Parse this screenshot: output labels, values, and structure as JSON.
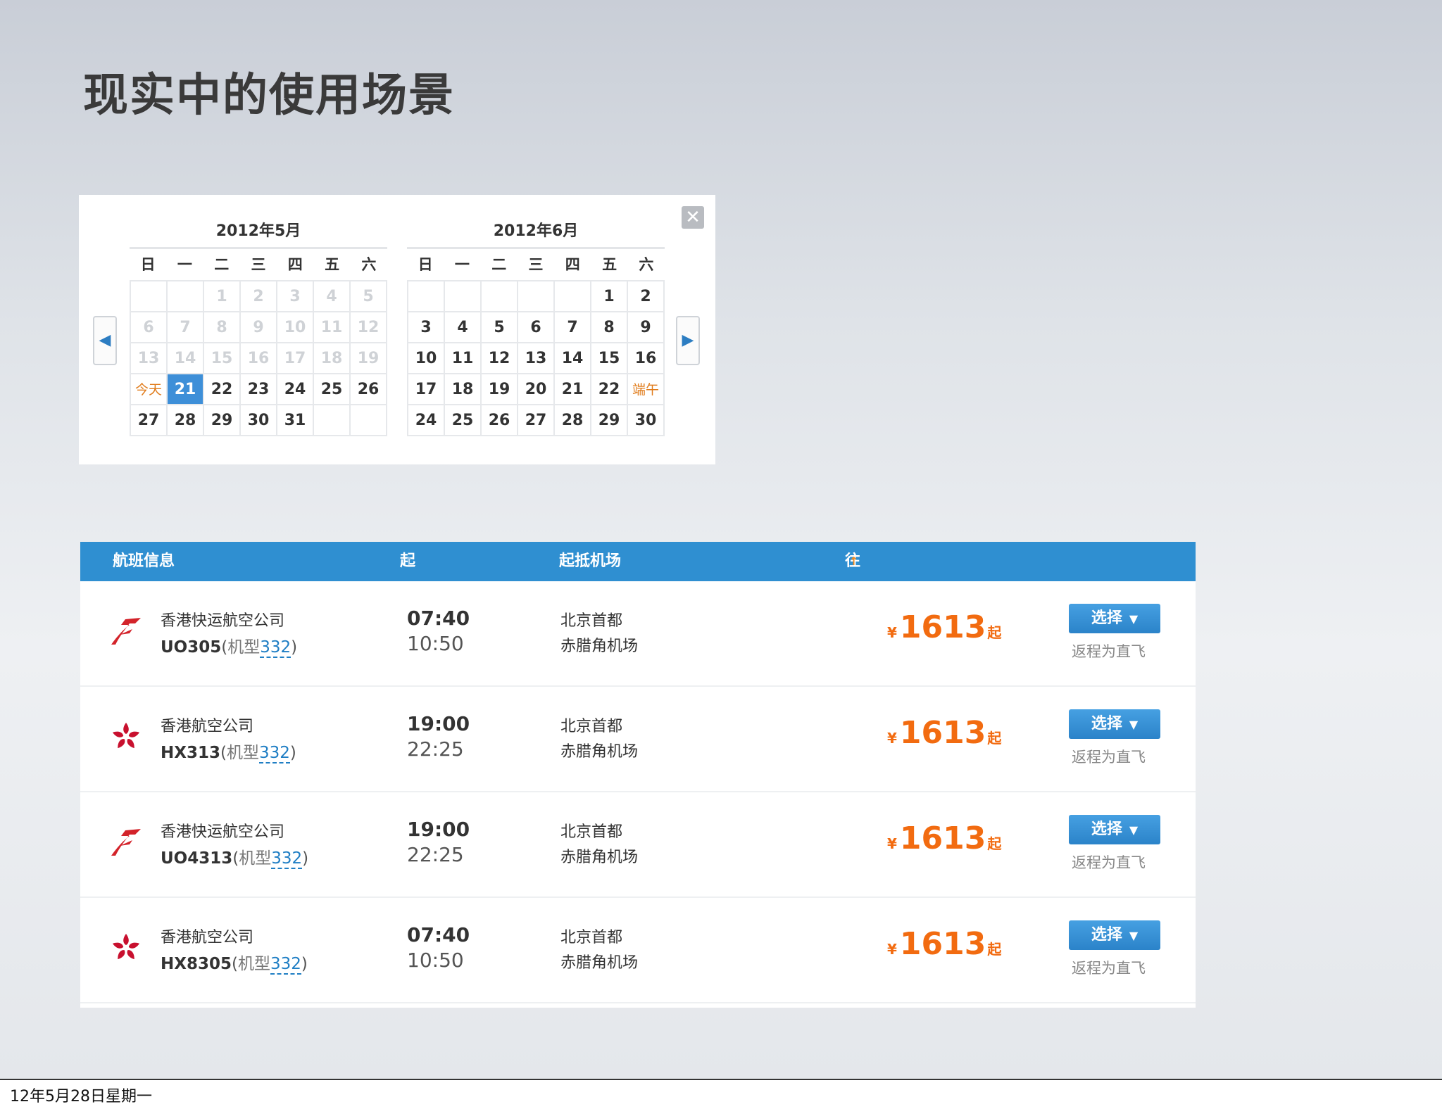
{
  "slide": {
    "title": "现实中的使用场景",
    "footer_date": "12年5月28日星期一"
  },
  "calendar": {
    "close_symbol": "✕",
    "prev_symbol": "◀",
    "next_symbol": "▶",
    "weekdays": [
      "日",
      "一",
      "二",
      "三",
      "四",
      "五",
      "六"
    ],
    "months": [
      {
        "title": "2012年5月",
        "days": [
          {
            "t": "",
            "s": "empty"
          },
          {
            "t": "",
            "s": "empty"
          },
          {
            "t": "1",
            "s": "past"
          },
          {
            "t": "2",
            "s": "past"
          },
          {
            "t": "3",
            "s": "past"
          },
          {
            "t": "4",
            "s": "past"
          },
          {
            "t": "5",
            "s": "past"
          },
          {
            "t": "6",
            "s": "past"
          },
          {
            "t": "7",
            "s": "past"
          },
          {
            "t": "8",
            "s": "past"
          },
          {
            "t": "9",
            "s": "past"
          },
          {
            "t": "10",
            "s": "past"
          },
          {
            "t": "11",
            "s": "past"
          },
          {
            "t": "12",
            "s": "past"
          },
          {
            "t": "13",
            "s": "past"
          },
          {
            "t": "14",
            "s": "past"
          },
          {
            "t": "15",
            "s": "past"
          },
          {
            "t": "16",
            "s": "past"
          },
          {
            "t": "17",
            "s": "past"
          },
          {
            "t": "18",
            "s": "past"
          },
          {
            "t": "19",
            "s": "past"
          },
          {
            "t": "今天",
            "s": "special"
          },
          {
            "t": "21",
            "s": "selected"
          },
          {
            "t": "22",
            "s": ""
          },
          {
            "t": "23",
            "s": ""
          },
          {
            "t": "24",
            "s": ""
          },
          {
            "t": "25",
            "s": ""
          },
          {
            "t": "26",
            "s": ""
          },
          {
            "t": "27",
            "s": ""
          },
          {
            "t": "28",
            "s": ""
          },
          {
            "t": "29",
            "s": ""
          },
          {
            "t": "30",
            "s": ""
          },
          {
            "t": "31",
            "s": ""
          },
          {
            "t": "",
            "s": "empty"
          },
          {
            "t": "",
            "s": "empty"
          }
        ]
      },
      {
        "title": "2012年6月",
        "days": [
          {
            "t": "",
            "s": "empty"
          },
          {
            "t": "",
            "s": "empty"
          },
          {
            "t": "",
            "s": "empty"
          },
          {
            "t": "",
            "s": "empty"
          },
          {
            "t": "",
            "s": "empty"
          },
          {
            "t": "1",
            "s": ""
          },
          {
            "t": "2",
            "s": ""
          },
          {
            "t": "3",
            "s": ""
          },
          {
            "t": "4",
            "s": ""
          },
          {
            "t": "5",
            "s": ""
          },
          {
            "t": "6",
            "s": ""
          },
          {
            "t": "7",
            "s": ""
          },
          {
            "t": "8",
            "s": ""
          },
          {
            "t": "9",
            "s": ""
          },
          {
            "t": "10",
            "s": ""
          },
          {
            "t": "11",
            "s": ""
          },
          {
            "t": "12",
            "s": ""
          },
          {
            "t": "13",
            "s": ""
          },
          {
            "t": "14",
            "s": ""
          },
          {
            "t": "15",
            "s": ""
          },
          {
            "t": "16",
            "s": ""
          },
          {
            "t": "17",
            "s": ""
          },
          {
            "t": "18",
            "s": ""
          },
          {
            "t": "19",
            "s": ""
          },
          {
            "t": "20",
            "s": ""
          },
          {
            "t": "21",
            "s": ""
          },
          {
            "t": "22",
            "s": ""
          },
          {
            "t": "端午",
            "s": "special"
          },
          {
            "t": "24",
            "s": ""
          },
          {
            "t": "25",
            "s": ""
          },
          {
            "t": "26",
            "s": ""
          },
          {
            "t": "27",
            "s": ""
          },
          {
            "t": "28",
            "s": ""
          },
          {
            "t": "29",
            "s": ""
          },
          {
            "t": "30",
            "s": ""
          }
        ]
      }
    ]
  },
  "flights": {
    "headers": {
      "info": "航班信息",
      "time": "起抵时间",
      "airport": "起抵机场",
      "price": "往返最低票价(不含税)"
    },
    "sort_arrow": "↑",
    "rows": [
      {
        "airline": "香港快运航空公司",
        "logo": "hk-express-logo-icon",
        "flight_no": "UO305",
        "open_paren": "(",
        "plane_label": "机型",
        "model": "332",
        "close_paren": ")",
        "dep": "07:40",
        "arr": "10:50",
        "dep_airport": "北京首都",
        "arr_airport": "赤腊角机场",
        "currency": "¥",
        "price": "1613",
        "price_suffix": "起",
        "select_label": "选择",
        "select_arrow": "▼",
        "return_note": "返程为直飞"
      },
      {
        "airline": "香港航空公司",
        "logo": "hong-kong-airlines-logo-icon",
        "flight_no": "HX313",
        "open_paren": "(",
        "plane_label": "机型",
        "model": "332",
        "close_paren": ")",
        "dep": "19:00",
        "arr": "22:25",
        "dep_airport": "北京首都",
        "arr_airport": "赤腊角机场",
        "currency": "¥",
        "price": "1613",
        "price_suffix": "起",
        "select_label": "选择",
        "select_arrow": "▼",
        "return_note": "返程为直飞"
      },
      {
        "airline": "香港快运航空公司",
        "logo": "hk-express-logo-icon",
        "flight_no": "UO4313",
        "open_paren": "(",
        "plane_label": "机型",
        "model": "332",
        "close_paren": ")",
        "dep": "19:00",
        "arr": "22:25",
        "dep_airport": "北京首都",
        "arr_airport": "赤腊角机场",
        "currency": "¥",
        "price": "1613",
        "price_suffix": "起",
        "select_label": "选择",
        "select_arrow": "▼",
        "return_note": "返程为直飞"
      },
      {
        "airline": "香港航空公司",
        "logo": "hong-kong-airlines-logo-icon",
        "flight_no": "HX8305",
        "open_paren": "(",
        "plane_label": "机型",
        "model": "332",
        "close_paren": ")",
        "dep": "07:40",
        "arr": "10:50",
        "dep_airport": "北京首都",
        "arr_airport": "赤腊角机场",
        "currency": "¥",
        "price": "1613",
        "price_suffix": "起",
        "select_label": "选择",
        "select_arrow": "▼",
        "return_note": "返程为直飞"
      }
    ]
  },
  "colors": {
    "header_blue": "#2f8fd1",
    "price_orange": "#f26b10",
    "selected_day": "#3e8fd8",
    "special_day": "#e07b1a"
  }
}
